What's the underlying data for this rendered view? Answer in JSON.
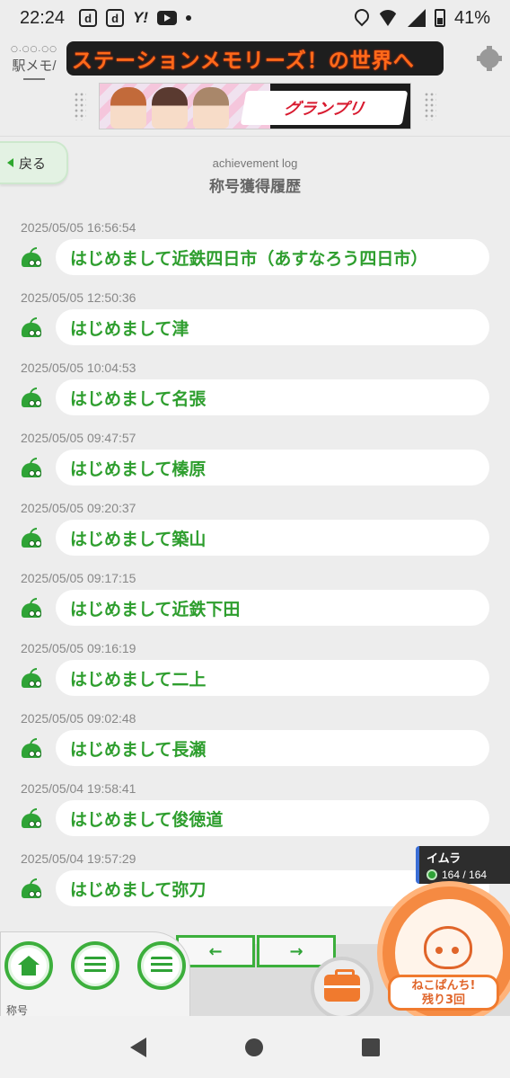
{
  "status_bar": {
    "time": "22:24",
    "notif_icons": [
      "d",
      "d",
      "Y!"
    ],
    "battery": "41%"
  },
  "header": {
    "logo_text": "駅メモ/",
    "marquee": "ステーションメモリーズ！の世界へ",
    "banner_text": "グランプリ"
  },
  "page": {
    "back_label": "戻る",
    "subtitle": "achievement log",
    "title": "称号獲得履歴"
  },
  "entries": [
    {
      "time": "2025/05/05 16:56:54",
      "title": "はじめまして近鉄四日市（あすなろう四日市）"
    },
    {
      "time": "2025/05/05 12:50:36",
      "title": "はじめまして津"
    },
    {
      "time": "2025/05/05 10:04:53",
      "title": "はじめまして名張"
    },
    {
      "time": "2025/05/05 09:47:57",
      "title": "はじめまして榛原"
    },
    {
      "time": "2025/05/05 09:20:37",
      "title": "はじめまして築山"
    },
    {
      "time": "2025/05/05 09:17:15",
      "title": "はじめまして近鉄下田"
    },
    {
      "time": "2025/05/05 09:16:19",
      "title": "はじめまして二上"
    },
    {
      "time": "2025/05/05 09:02:48",
      "title": "はじめまして長瀬"
    },
    {
      "time": "2025/05/04 19:58:41",
      "title": "はじめまして俊徳道"
    },
    {
      "time": "2025/05/04 19:57:29",
      "title": "はじめまして弥刀"
    }
  ],
  "player": {
    "name": "イムラ",
    "hp": "164 / 164"
  },
  "bottom_bar": {
    "section_label": "称号",
    "prev": "←",
    "next": "→",
    "neko_line1": "ねこぱんち!",
    "neko_line2": "残り3回"
  },
  "colors": {
    "accent_green": "#2e9e2e",
    "marquee_orange": "#ff6a1a",
    "neko_orange": "#f58a42"
  }
}
